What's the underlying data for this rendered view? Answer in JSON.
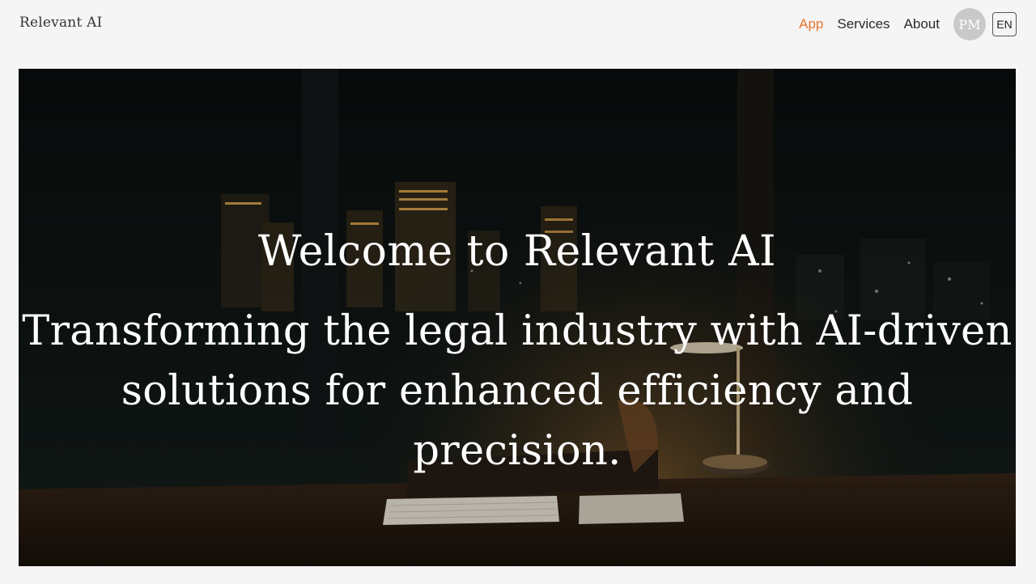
{
  "header": {
    "brand": "Relevant AI",
    "nav": {
      "app": "App",
      "services": "Services",
      "about": "About"
    },
    "avatar_initials": "PM",
    "language": "EN",
    "active_color": "#e8742c"
  },
  "hero": {
    "title": "Welcome to Relevant AI",
    "subtitle": "Transforming the legal industry with AI-driven solutions for enhanced efficiency and precision."
  }
}
